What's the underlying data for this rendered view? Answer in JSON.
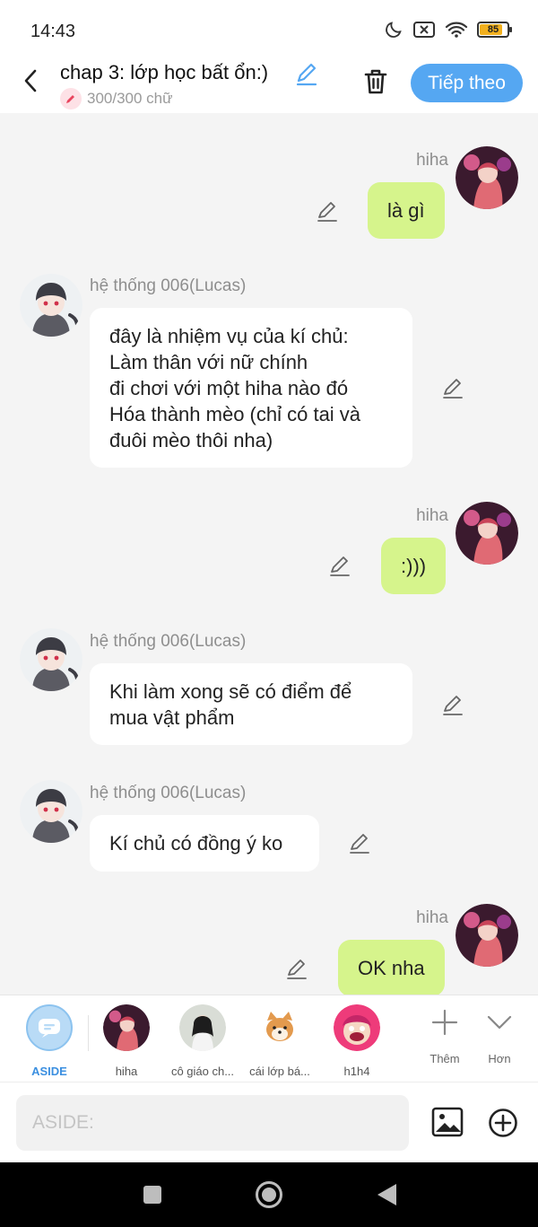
{
  "status": {
    "time": "14:43",
    "battery": "85",
    "battery_level": 0.85
  },
  "header": {
    "title": "chap 3: lớp học bất ổn:)",
    "word_count": "300/300 chữ",
    "next_label": "Tiếp theo"
  },
  "messages": [
    {
      "side": "right",
      "name": "hiha",
      "lines": [
        "là gì"
      ]
    },
    {
      "side": "left",
      "name": "hệ thống 006(Lucas)",
      "lines": [
        "đây là nhiệm vụ của kí chủ:",
        "Làm thân với nữ chính",
        "đi chơi với một hiha nào đó",
        "Hóa thành mèo (chỉ có tai và",
        "đuôi mèo thôi nha)"
      ]
    },
    {
      "side": "right",
      "name": "hiha",
      "lines": [
        ":)))"
      ]
    },
    {
      "side": "left",
      "name": "hệ thống 006(Lucas)",
      "lines": [
        "Khi làm xong sẽ có điểm để",
        "mua vật phẩm"
      ]
    },
    {
      "side": "left",
      "name": "hệ thống 006(Lucas)",
      "lines": [
        "Kí chủ có đồng ý ko"
      ]
    },
    {
      "side": "right",
      "name": "hiha",
      "lines": [
        "OK nha"
      ]
    }
  ],
  "characters": [
    {
      "label": "ASIDE",
      "icon": "chat-bubble-icon"
    },
    {
      "label": "hiha",
      "icon": "avatar-pink-hair"
    },
    {
      "label": "cô giáo ch...",
      "icon": "avatar-teacher"
    },
    {
      "label": "cái lớp bá...",
      "icon": "avatar-shiba-dog"
    },
    {
      "label": "h1h4",
      "icon": "avatar-pink-cartoon"
    }
  ],
  "tools": {
    "add_label": "Thêm",
    "more_label": "Hơn"
  },
  "composer": {
    "placeholder": "ASIDE:"
  },
  "colors": {
    "accent": "#55a7f2",
    "my_bubble": "#d6f48c",
    "other_bubble": "#ffffff",
    "background": "#f4f4f4"
  }
}
